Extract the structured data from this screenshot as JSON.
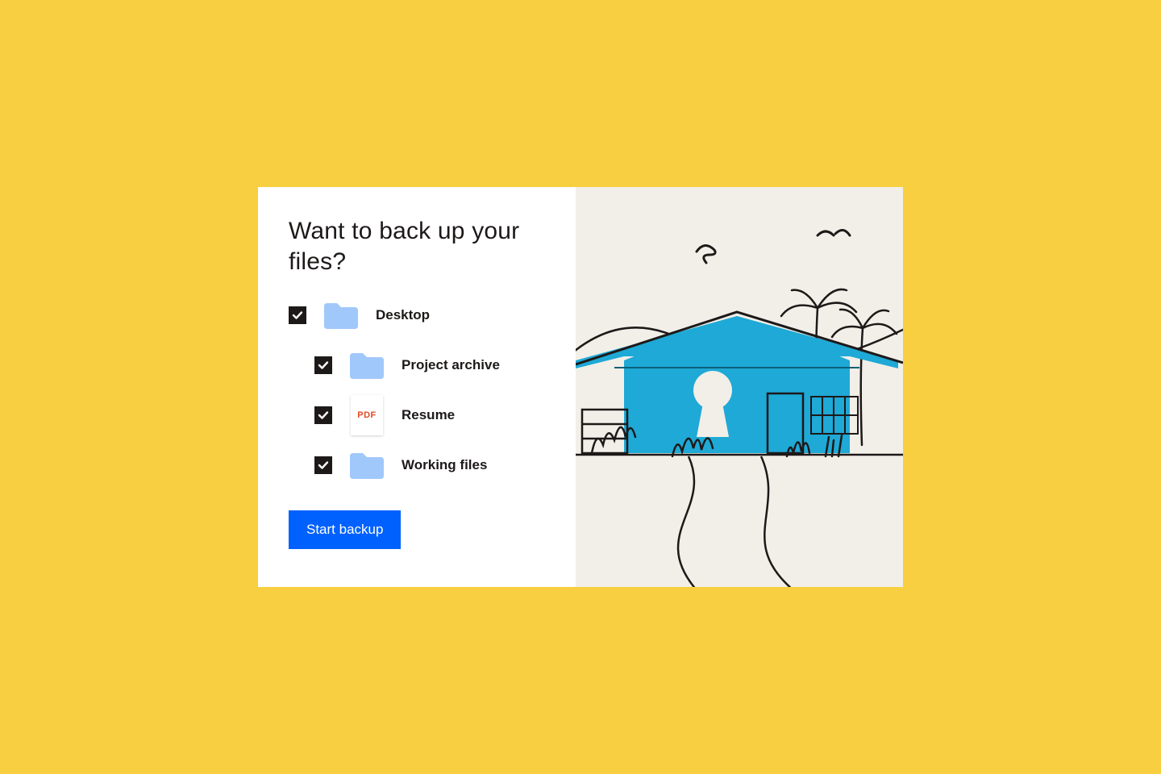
{
  "colors": {
    "page_bg": "#f7cf40",
    "card_bg": "#ffffff",
    "illustration_bg": "#f2efe8",
    "text": "#1e1919",
    "accent": "#0061fe",
    "folder": "#a1c8fb",
    "house": "#1ea9d6",
    "pdf_red": "#e24b26"
  },
  "title": "Want to back up your files?",
  "items": [
    {
      "label": "Desktop",
      "checked": true,
      "icon": "folder",
      "indent": false
    },
    {
      "label": "Project archive",
      "checked": true,
      "icon": "folder",
      "indent": true
    },
    {
      "label": "Resume",
      "checked": true,
      "icon": "pdf",
      "indent": true
    },
    {
      "label": "Working files",
      "checked": true,
      "icon": "folder",
      "indent": true
    }
  ],
  "pdf_badge": "PDF",
  "cta_label": "Start backup",
  "illustration_name": "secure-house-illustration"
}
